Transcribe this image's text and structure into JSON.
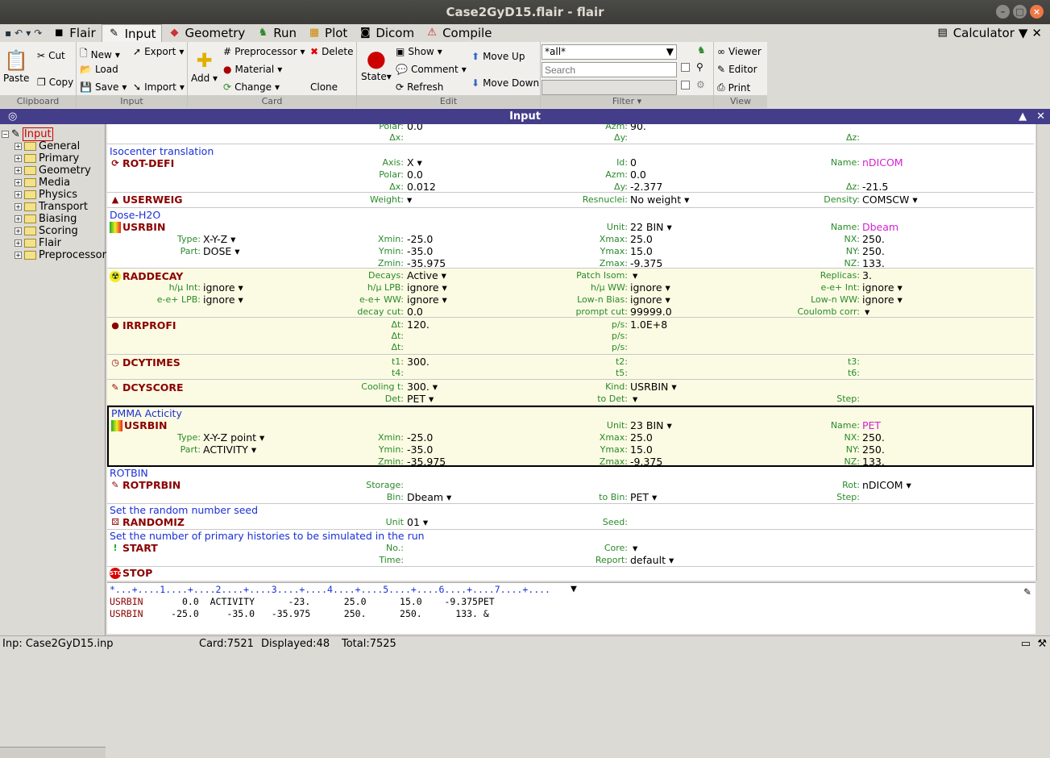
{
  "window": {
    "title": "Case2GyD15.flair - flair"
  },
  "menu": {
    "tabs": [
      {
        "label": "Flair",
        "icon": "flair-icon"
      },
      {
        "label": "Input",
        "icon": "input-icon"
      },
      {
        "label": "Geometry",
        "icon": "geometry-icon"
      },
      {
        "label": "Run",
        "icon": "run-icon"
      },
      {
        "label": "Plot",
        "icon": "plot-icon"
      },
      {
        "label": "Dicom",
        "icon": "dicom-icon"
      },
      {
        "label": "Compile",
        "icon": "compile-icon"
      }
    ],
    "calculator": "Calculator"
  },
  "ribbon": {
    "clipboard": {
      "paste": "Paste",
      "cut": "Cut",
      "copy": "Copy",
      "label": "Clipboard"
    },
    "input": {
      "new": "New",
      "load": "Load",
      "save": "Save",
      "export": "Export",
      "import": "Import",
      "label": "Input"
    },
    "card": {
      "add": "Add",
      "preprocessor": "Preprocessor",
      "material": "Material",
      "change": "Change",
      "delete": "Delete",
      "clone": "Clone",
      "label": "Card"
    },
    "edit": {
      "state": "State",
      "show": "Show",
      "comment": "Comment",
      "refresh": "Refresh",
      "move_up": "Move Up",
      "move_down": "Move Down",
      "label": "Edit"
    },
    "filter": {
      "value": "*all*",
      "search_placeholder": "Search",
      "label": "Filter"
    },
    "view": {
      "viewer": "Viewer",
      "editor": "Editor",
      "print": "Print",
      "label": "View"
    }
  },
  "panel": {
    "title": "Input"
  },
  "tree": {
    "root": "Input",
    "items": [
      "General",
      "Primary",
      "Geometry",
      "Media",
      "Physics",
      "Transport",
      "Biasing",
      "Scoring",
      "Flair",
      "Preprocessor"
    ]
  },
  "cards": {
    "top": {
      "polar": "Polar:",
      "polar_val": "0.0",
      "azm": "Azm:",
      "azm_val": "90.",
      "dx": "Δx:",
      "dy": "Δy:",
      "dz": "Δz:"
    },
    "rotdefi": {
      "comment": "Isocenter translation",
      "name": "ROT-DEFI",
      "axis_l": "Axis:",
      "axis": "X ▾",
      "id_l": "Id:",
      "id": "0",
      "name_l": "Name:",
      "nm": "nDICOM",
      "polar_l": "Polar:",
      "polar": "0.0",
      "azm_l": "Azm:",
      "azm": "0.0",
      "dx_l": "Δx:",
      "dx": "0.012",
      "dy_l": "Δy:",
      "dy": "-2.377",
      "dz_l": "Δz:",
      "dz": "-21.5"
    },
    "userweig": {
      "name": "USERWEIG",
      "weight_l": "Weight:",
      "weight": "▾",
      "resn_l": "Resnuclei:",
      "resn": "No weight ▾",
      "dens_l": "Density:",
      "dens": "COMSCW ▾"
    },
    "usrbin1": {
      "comment": "Dose-H2O",
      "name": "USRBIN",
      "unit_l": "Unit:",
      "unit": "22 BIN ▾",
      "name_l": "Name:",
      "nm": "Dbeam",
      "type_l": "Type:",
      "type": "X-Y-Z ▾",
      "xmin_l": "Xmin:",
      "xmin": "-25.0",
      "xmax_l": "Xmax:",
      "xmax": "25.0",
      "nx_l": "NX:",
      "nx": "250.",
      "part_l": "Part:",
      "part": "DOSE ▾",
      "ymin_l": "Ymin:",
      "ymin": "-35.0",
      "ymax_l": "Ymax:",
      "ymax": "15.0",
      "ny_l": "NY:",
      "ny": "250.",
      "zmin_l": "Zmin:",
      "zmin": "-35.975",
      "zmax_l": "Zmax:",
      "zmax": "-9.375",
      "nz_l": "NZ:",
      "nz": "133."
    },
    "raddecay": {
      "name": "RADDECAY",
      "decays_l": "Decays:",
      "decays": "Active ▾",
      "patch_l": "Patch Isom:",
      "patch": "▾",
      "repl_l": "Replicas:",
      "repl": "3.",
      "hmuint_l": "h/μ Int:",
      "hmuint": "ignore ▾",
      "hmulpb_l": "h/μ LPB:",
      "hmulpb": "ignore ▾",
      "hmuww_l": "h/μ WW:",
      "hmuww": "ignore ▾",
      "eeint_l": "e-e+ Int:",
      "eeint": "ignore ▾",
      "eelpb_l": "e-e+ LPB:",
      "eelpb": "ignore ▾",
      "eeww_l": "e-e+ WW:",
      "eeww": "ignore ▾",
      "lownb_l": "Low-n Bias:",
      "lownb": "ignore ▾",
      "lownww_l": "Low-n WW:",
      "lownww": "ignore ▾",
      "dcut_l": "decay cut:",
      "dcut": "0.0",
      "pcut_l": "prompt cut:",
      "pcut": "99999.0",
      "coul_l": "Coulomb corr:",
      "coul": "▾"
    },
    "irrprofi": {
      "name": "IRRPROFI",
      "dt1_l": "Δt:",
      "dt1": "120.",
      "ps1_l": "p/s:",
      "ps1": "1.0E+8",
      "dt2_l": "Δt:",
      "ps2_l": "p/s:",
      "dt3_l": "Δt:",
      "ps3_l": "p/s:"
    },
    "dcytimes": {
      "name": "DCYTIMES",
      "t1_l": "t1:",
      "t1": "300.",
      "t2_l": "t2:",
      "t3_l": "t3:",
      "t4_l": "t4:",
      "t5_l": "t5:",
      "t6_l": "t6:"
    },
    "dcyscore": {
      "name": "DCYSCORE",
      "cool_l": "Cooling t:",
      "cool": "300. ▾",
      "kind_l": "Kind:",
      "kind": "USRBIN ▾",
      "det_l": "Det:",
      "det": "PET ▾",
      "todet_l": "to Det:",
      "todet": "▾",
      "step_l": "Step:"
    },
    "usrbin2": {
      "comment": "PMMA Acticity",
      "name": "USRBIN",
      "unit_l": "Unit:",
      "unit": "23 BIN ▾",
      "name_l": "Name:",
      "nm": "PET",
      "type_l": "Type:",
      "type": "X-Y-Z point ▾",
      "xmin_l": "Xmin:",
      "xmin": "-25.0",
      "xmax_l": "Xmax:",
      "xmax": "25.0",
      "nx_l": "NX:",
      "nx": "250.",
      "part_l": "Part:",
      "part": "ACTIVITY ▾",
      "ymin_l": "Ymin:",
      "ymin": "-35.0",
      "ymax_l": "Ymax:",
      "ymax": "15.0",
      "ny_l": "NY:",
      "ny": "250.",
      "zmin_l": "Zmin:",
      "zmin": "-35.975",
      "zmax_l": "Zmax:",
      "zmax": "-9.375",
      "nz_l": "NZ:",
      "nz": "133."
    },
    "rotprbin": {
      "comment": "ROTBIN",
      "name": "ROTPRBIN",
      "storage_l": "Storage:",
      "rot_l": "Rot:",
      "rot": "nDICOM ▾",
      "bin_l": "Bin:",
      "bin": "Dbeam ▾",
      "tobin_l": "to Bin:",
      "tobin": "PET ▾",
      "step_l": "Step:"
    },
    "randomiz": {
      "comment": "Set the random number seed",
      "name": "RANDOMIZ",
      "unit_l": "Unit",
      "unit": "01 ▾",
      "seed_l": "Seed:"
    },
    "start": {
      "comment": "Set the number of primary histories to be simulated in the run",
      "name": "START",
      "no_l": "No.:",
      "core_l": "Core:",
      "core": "▾",
      "time_l": "Time:",
      "report_l": "Report:",
      "report": "default ▾"
    },
    "stop": {
      "name": "STOP"
    }
  },
  "editor": {
    "ruler": "*...+....1....+....2....+....3....+....4....+....5....+....6....+....7....+....",
    "line1_name": "USRBIN",
    "line1": "       0.0  ACTIVITY      -23.      25.0      15.0    -9.375PET",
    "line2_name": "USRBIN",
    "line2": "     -25.0     -35.0   -35.975      250.      250.      133. &"
  },
  "status": {
    "file": "Inp: Case2GyD15.inp",
    "card": "Card:7521",
    "displayed": "Displayed:48",
    "total": "Total:7525"
  }
}
